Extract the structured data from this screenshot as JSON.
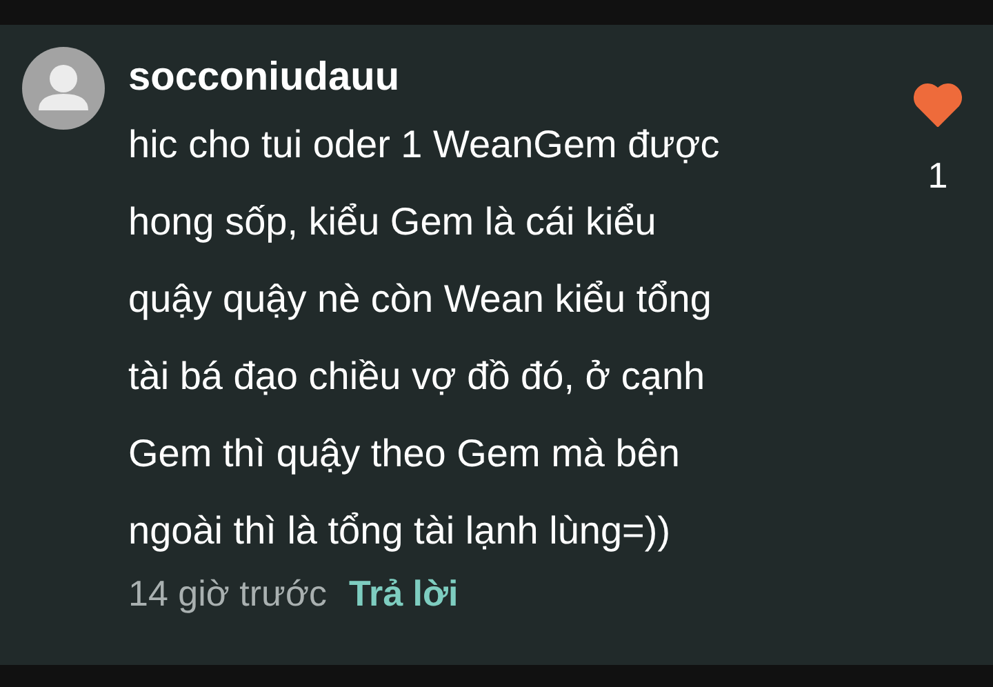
{
  "comment": {
    "username": "socconiudauu",
    "text": "hic cho tui oder 1 WeanGem được\nhong sốp, kiểu Gem là cái kiểu\nquậy quậy nè còn Wean kiểu tổng\ntài bá đạo chiều vợ đồ đó, ở cạnh\nGem thì quậy theo Gem mà bên\nngoài thì là tổng tài lạnh lùng=))",
    "time": "14 giờ trước",
    "reply": "Trả lời",
    "liked": true,
    "likes": "1"
  }
}
